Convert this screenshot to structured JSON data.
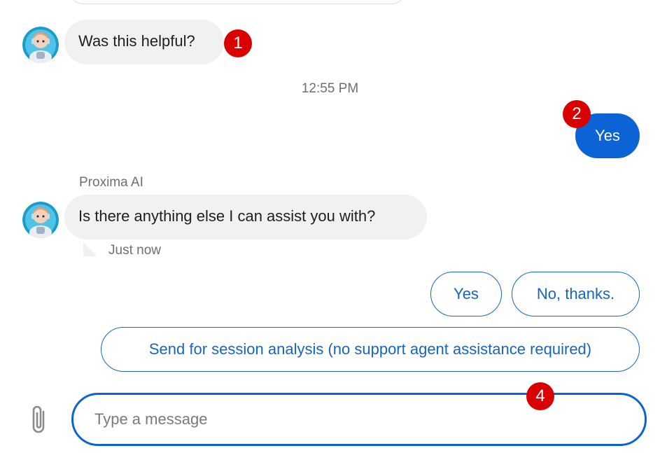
{
  "messages": {
    "bot_first": "Was this helpful?",
    "timestamp": "12:55 PM",
    "user_reply": "Yes",
    "sender_name": "Proxima AI",
    "bot_second": "Is there anything else I can assist you with?",
    "bot_second_time": "Just now"
  },
  "quick_replies": {
    "yes": "Yes",
    "no": "No, thanks.",
    "send_analysis": "Send for session analysis (no support agent assistance required)"
  },
  "composer": {
    "placeholder": "Type a message",
    "value": ""
  },
  "markers": {
    "m1": "1",
    "m2": "2",
    "m4": "4"
  },
  "colors": {
    "accent": "#0b63d6",
    "bot_bubble": "#f1f1f3",
    "marker": "#d80000"
  },
  "icons": {
    "avatar": "robot-avatar-icon",
    "attach": "paperclip-icon"
  }
}
